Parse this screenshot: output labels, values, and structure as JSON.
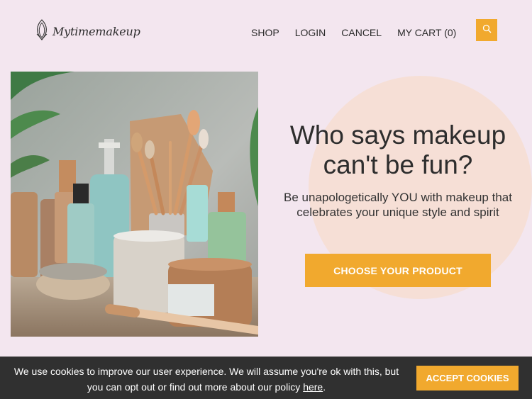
{
  "header": {
    "brand": "Mytimemakeup",
    "nav": {
      "shop": "SHOP",
      "login": "LOGIN",
      "cancel": "CANCEL",
      "cart": "MY CART (0)"
    }
  },
  "hero": {
    "title": "Who says makeup can't be fun?",
    "subtitle": "Be unapologetically YOU with makeup that celebrates your unique style and spirit",
    "cta": "CHOOSE YOUR PRODUCT"
  },
  "cookies": {
    "message": "We use cookies to improve our user experience. We will assume you're ok with this, but you can opt out or find out more about our policy ",
    "link": "here",
    "end": ".",
    "accept": "ACCEPT COOKIES"
  },
  "colors": {
    "background": "#f3e6ef",
    "accent": "#f1a92e",
    "circle": "#f6dfd6",
    "cookie_bar": "#303030"
  }
}
